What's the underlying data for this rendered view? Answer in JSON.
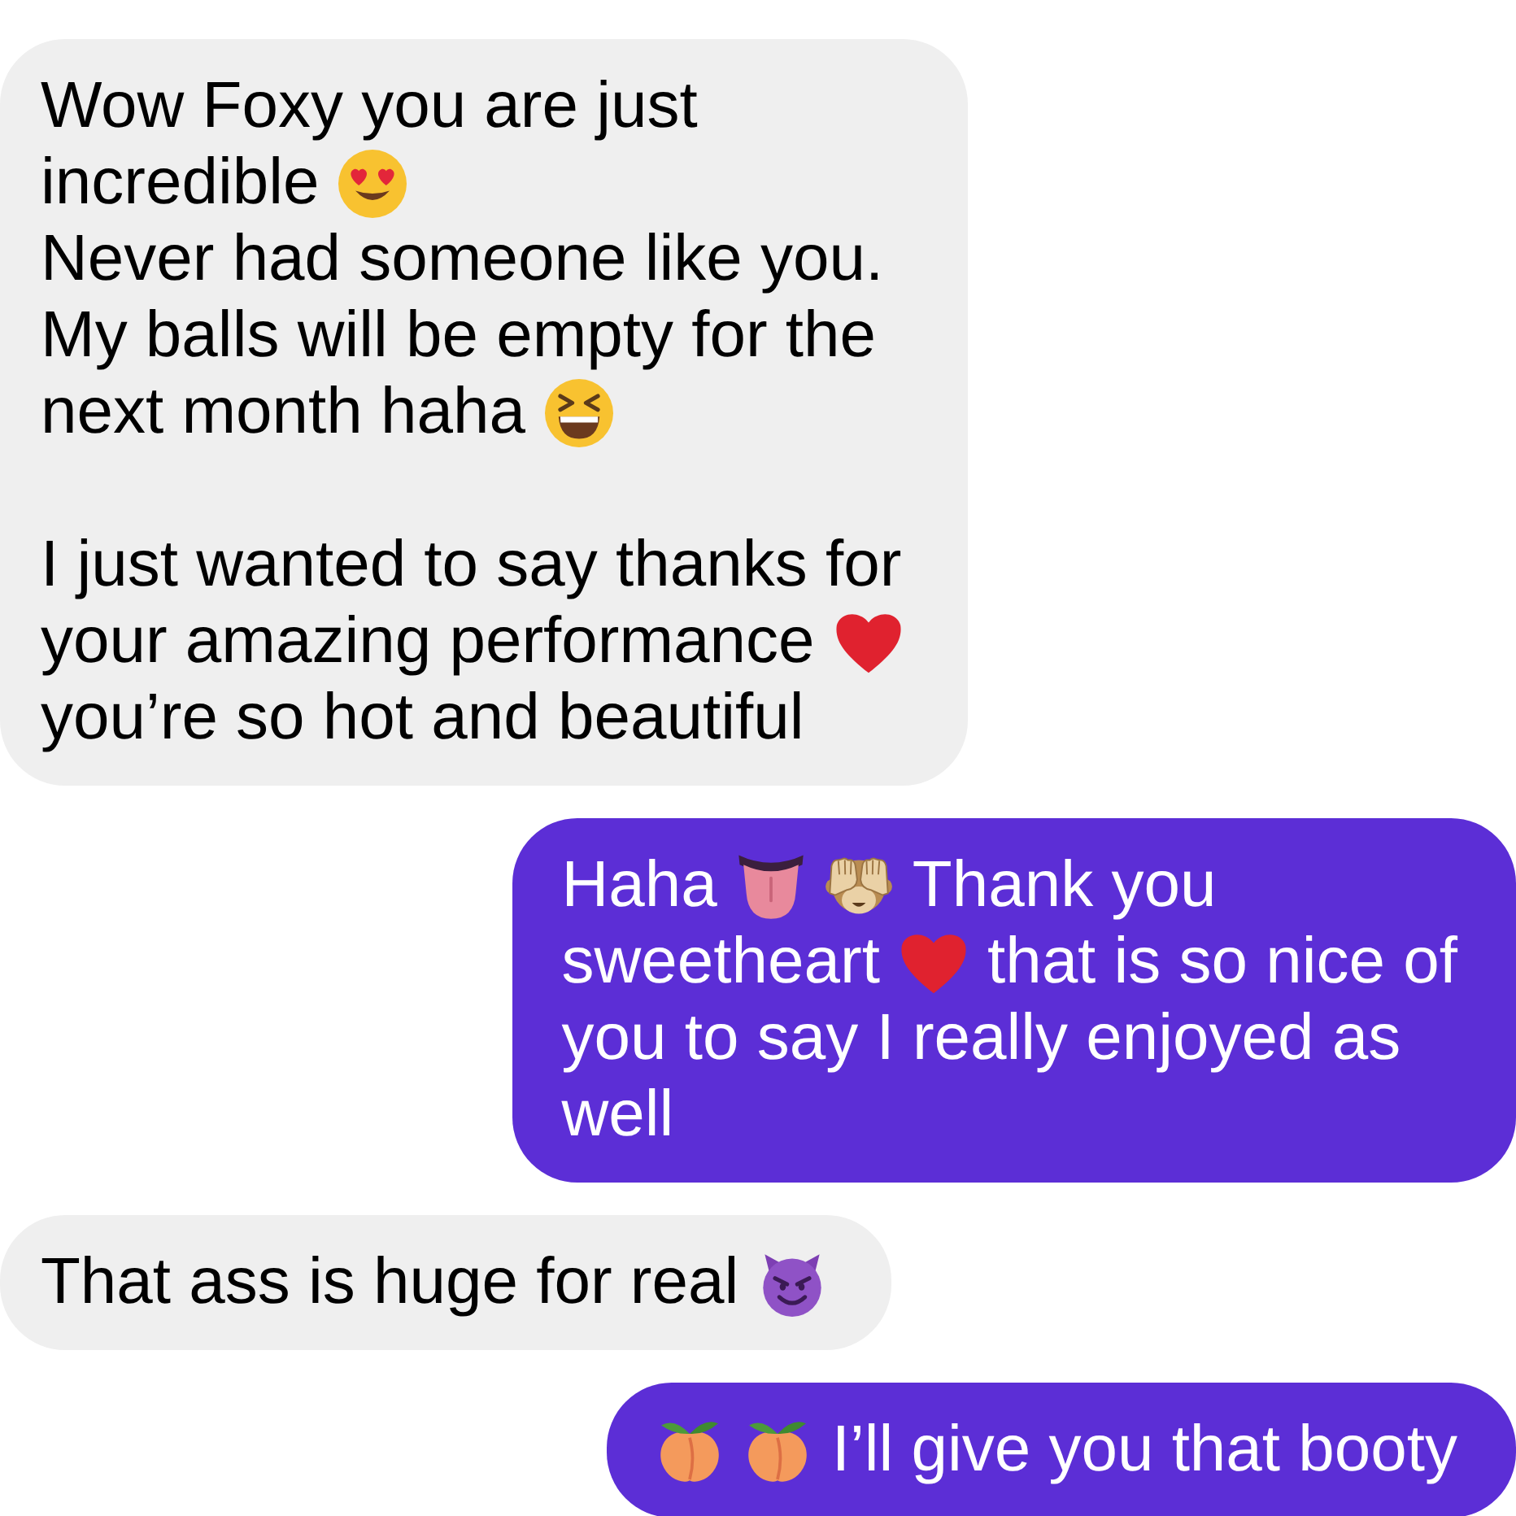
{
  "messages": [
    {
      "kind": "received",
      "paragraphs": [
        {
          "lines": [
            {
              "parts": [
                {
                  "kind": "text",
                  "text": "Wow Foxy you are just"
                }
              ]
            },
            {
              "parts": [
                {
                  "kind": "text",
                  "text": "incredible"
                },
                {
                  "kind": "lovestruck"
                }
              ]
            },
            {
              "parts": [
                {
                  "kind": "text",
                  "text": "Never had someone like you."
                }
              ]
            },
            {
              "parts": [
                {
                  "kind": "text",
                  "text": "My balls will be empty for the"
                }
              ]
            },
            {
              "parts": [
                {
                  "kind": "text",
                  "text": "next month haha"
                },
                {
                  "kind": "laughing"
                }
              ]
            }
          ]
        },
        {
          "lines": [
            {
              "parts": [
                {
                  "kind": "text",
                  "text": "I just wanted to say thanks for"
                }
              ]
            },
            {
              "parts": [
                {
                  "kind": "text",
                  "text": "your amazing performance"
                },
                {
                  "kind": "heart"
                }
              ]
            },
            {
              "parts": [
                {
                  "kind": "text",
                  "text": "you’re so hot and beautiful"
                }
              ]
            }
          ]
        }
      ]
    },
    {
      "kind": "sent",
      "paragraphs": [
        {
          "lines": [
            {
              "parts": [
                {
                  "kind": "text",
                  "text": "Haha"
                },
                {
                  "kind": "tongue"
                },
                {
                  "kind": "monkey"
                },
                {
                  "kind": "text",
                  "text": "Thank you"
                }
              ]
            },
            {
              "parts": [
                {
                  "kind": "text",
                  "text": "sweetheart"
                },
                {
                  "kind": "heart"
                },
                {
                  "kind": "text",
                  "text": "that is so nice of"
                }
              ]
            },
            {
              "parts": [
                {
                  "kind": "text",
                  "text": "you to say I really enjoyed as"
                }
              ]
            },
            {
              "parts": [
                {
                  "kind": "text",
                  "text": "well"
                }
              ]
            }
          ]
        }
      ]
    },
    {
      "kind": "received",
      "paragraphs": [
        {
          "lines": [
            {
              "parts": [
                {
                  "kind": "text",
                  "text": "That ass is huge for real"
                },
                {
                  "kind": "devil"
                }
              ]
            }
          ]
        }
      ]
    },
    {
      "kind": "sent",
      "paragraphs": [
        {
          "lines": [
            {
              "parts": [
                {
                  "kind": "peach"
                },
                {
                  "kind": "peach"
                },
                {
                  "kind": "text",
                  "text": "I’ll give you that booty"
                }
              ]
            }
          ]
        }
      ]
    }
  ]
}
